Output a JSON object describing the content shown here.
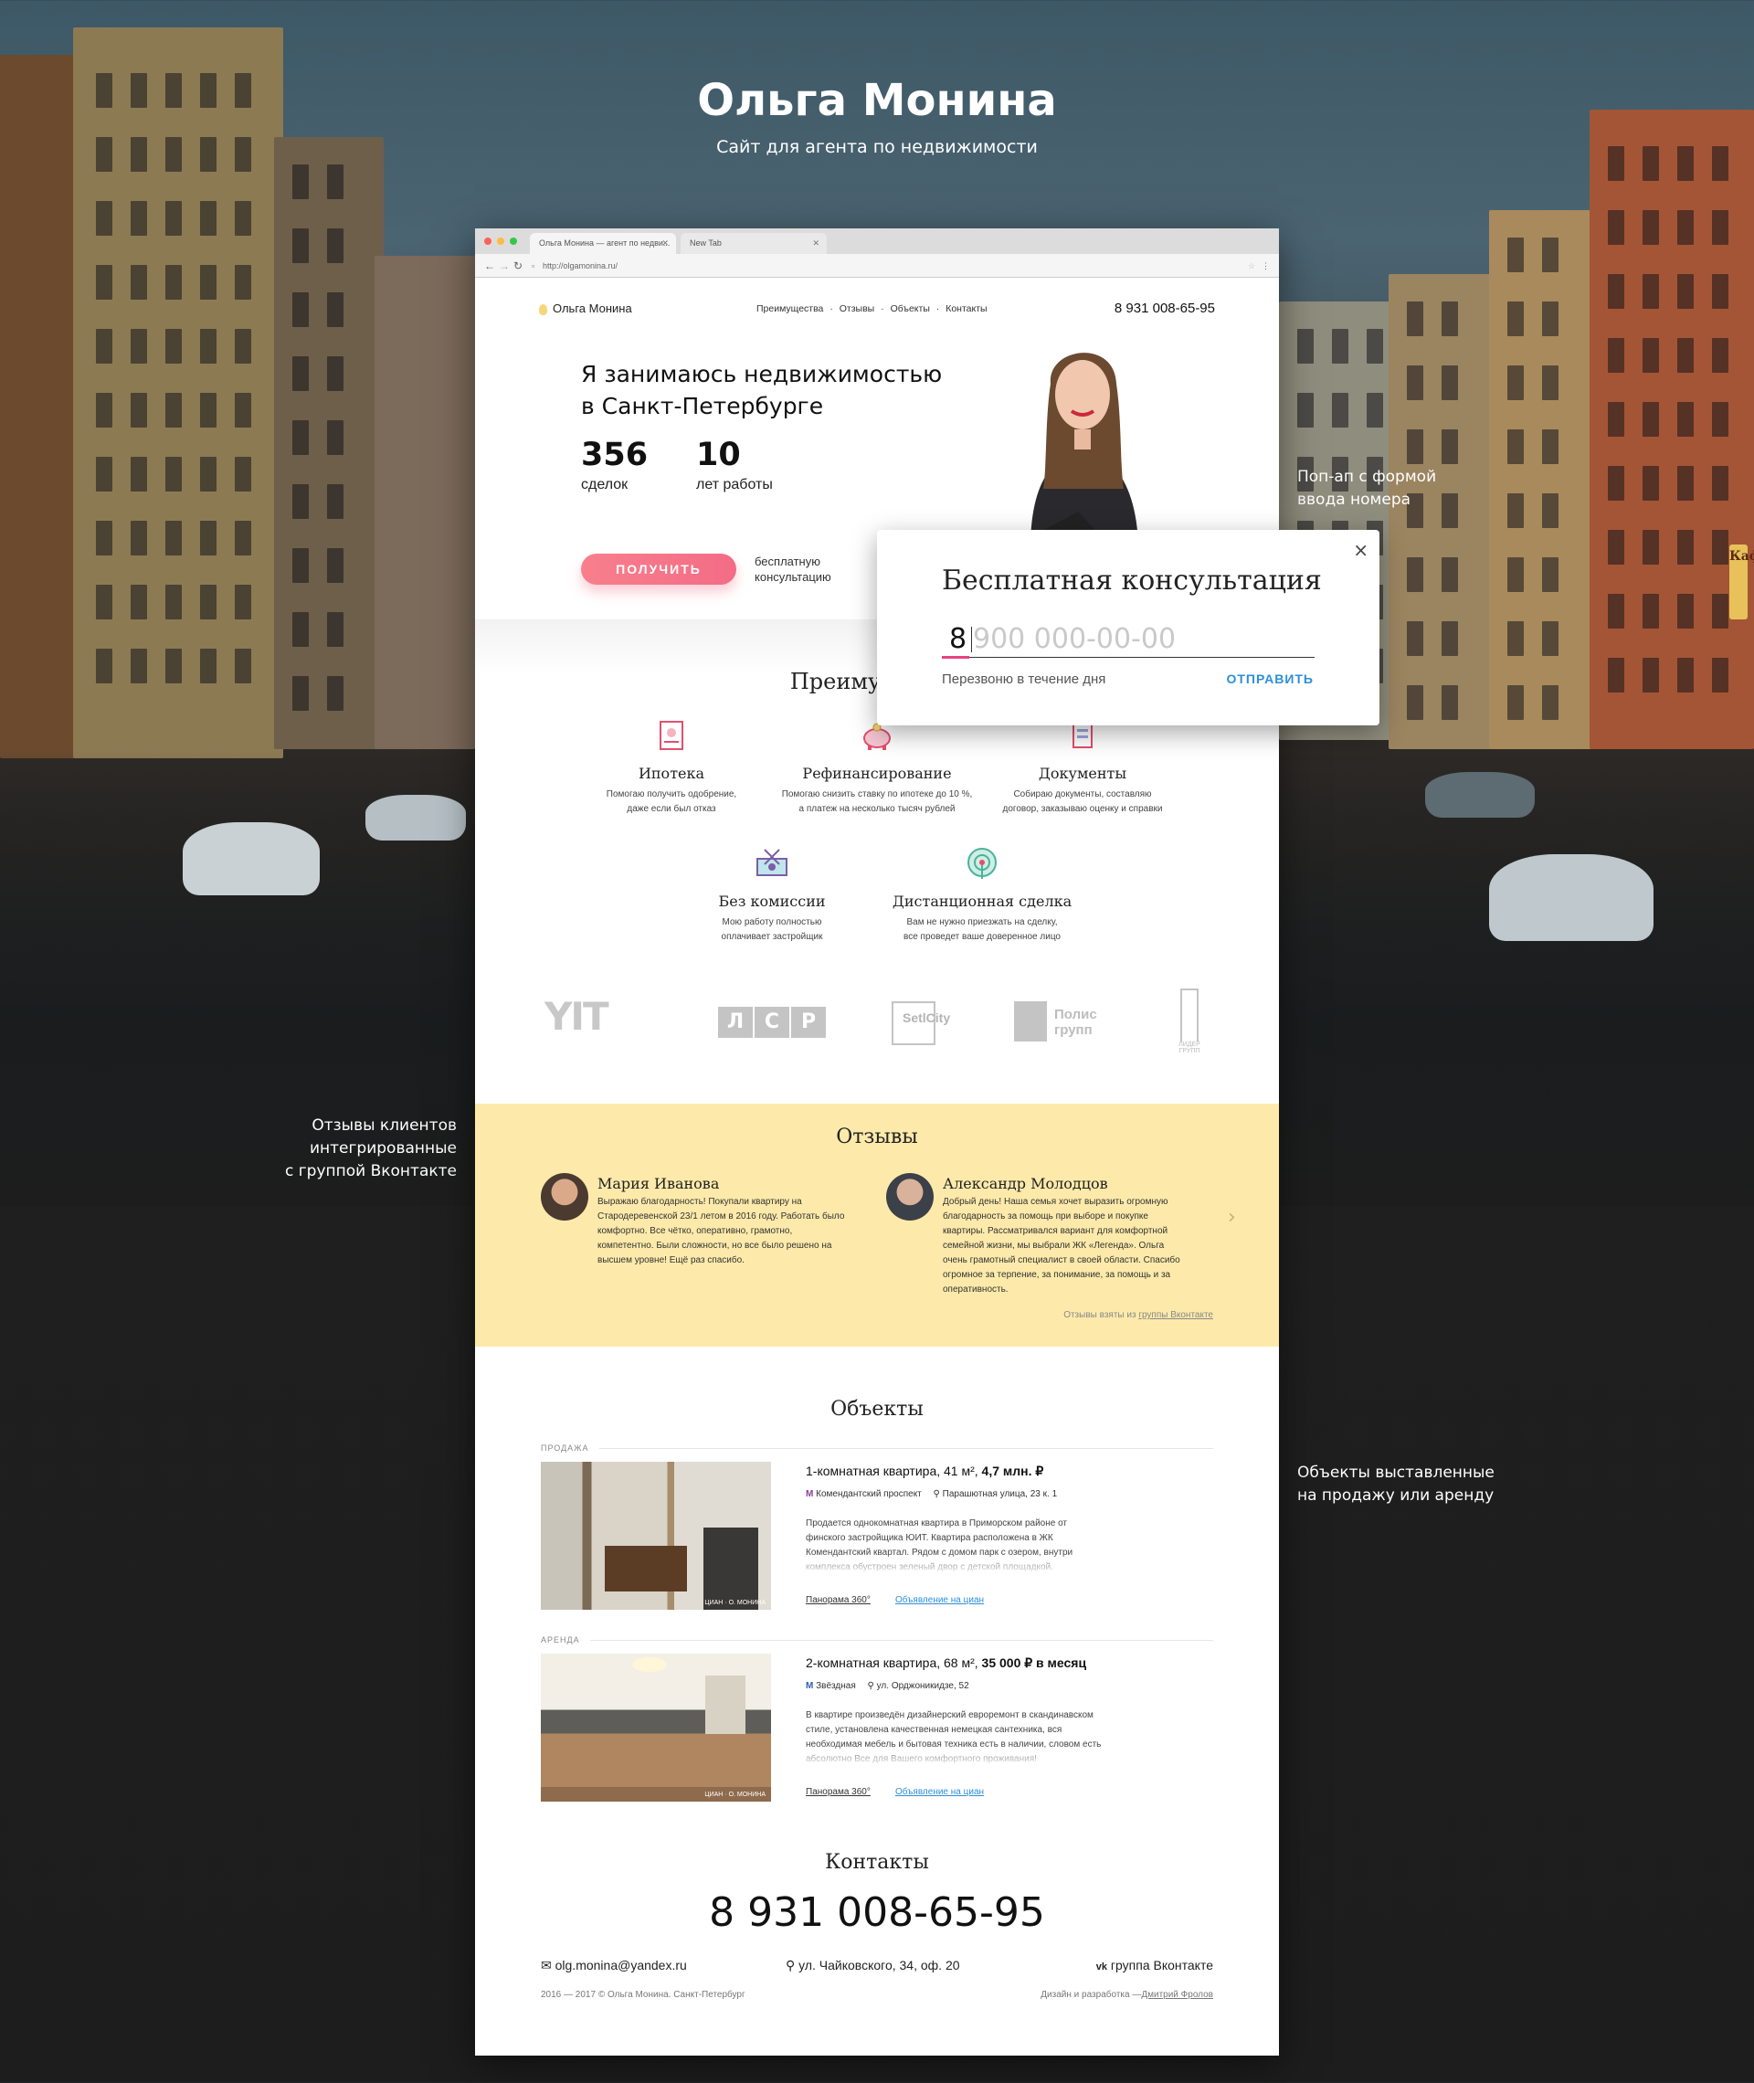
{
  "showcase": {
    "title": "Ольга Монина",
    "subtitle": "Сайт для агента по недвижимости",
    "notes": {
      "popup": [
        "Поп-ап с формой",
        "ввода номера"
      ],
      "reviews": [
        "Отзывы клиентов",
        "интегрированные",
        "с группой Вконтакте"
      ],
      "objects": [
        "Объекты выставленные",
        "на продажу или аренду"
      ]
    },
    "cafe_sign": "Кафе"
  },
  "browser": {
    "tabs": [
      {
        "label": "Ольга Монина — агент по недви..."
      },
      {
        "label": "New Tab"
      }
    ],
    "url": "http://olgamonina.ru/",
    "dots": [
      "#fc605c",
      "#fdbc40",
      "#34c84a"
    ]
  },
  "site": {
    "logo": "Ольга Монина",
    "menu": [
      "Преимущества",
      "Отзывы",
      "Объекты",
      "Контакты"
    ],
    "menu_sep": "·",
    "phone": "8 931 008-65-95",
    "hero": {
      "line1": "Я занимаюсь недвижимостью",
      "line2": "в Санкт-Петербурге",
      "stats": [
        {
          "value": "356",
          "label": "сделок"
        },
        {
          "value": "10",
          "label": "лет работы"
        }
      ],
      "cta": "ПОЛУЧИТЬ",
      "cta_note": [
        "бесплатную",
        "консультацию"
      ]
    },
    "advantages": {
      "title": "Преимущества",
      "items": [
        {
          "title": "Ипотека",
          "desc": [
            "Помогаю получить одобрение,",
            "даже если был отказ"
          ]
        },
        {
          "title": "Рефинансирование",
          "desc": [
            "Помогаю снизить ставку по ипотеке до 10 %,",
            "а платеж на несколько тысяч рублей"
          ]
        },
        {
          "title": "Документы",
          "desc": [
            "Собираю документы, составляю",
            "договор, заказываю оценку и справки"
          ]
        },
        {
          "title": "Без комиссии",
          "desc": [
            "Мою работу полностью",
            "оплачивает застройщик"
          ]
        },
        {
          "title": "Дистанционная сделка",
          "desc": [
            "Вам не нужно приезжать на сделку,",
            "все проведет ваше доверенное лицо"
          ]
        }
      ]
    },
    "partners": [
      "YIT",
      "ЛСР",
      "SetlCity",
      "Полис групп",
      "Лидер групп"
    ],
    "partner_parts": {
      "lsr": [
        "Л",
        "С",
        "Р"
      ],
      "polis": [
        "Полис",
        "групп"
      ],
      "lider": [
        "ЛИДЕР",
        "ГРУПП"
      ]
    },
    "reviews": {
      "title": "Отзывы",
      "items": [
        {
          "name": "Мария Иванова",
          "text": [
            "Выражаю благодарность! Покупали квартиру на",
            "Стародеревенской 23/1 летом в 2016 году. Работать было",
            "комфортно. Все чётко, оперативно, грамотно,",
            "компетентно. Были сложности, но все было решено на",
            "высшем уровне! Ещё раз спасибо."
          ]
        },
        {
          "name": "Александр Молодцов",
          "text": [
            "Добрый день! Наша семья хочет выразить огромную",
            "благодарность за помощь при выборе и покупке",
            "квартиры. Рассматривался вариант для комфортной",
            "семейной жизни, мы выбрали ЖК «Легенда». Ольга",
            "очень грамотный специалист в своей области. Спасибо",
            "огромное за терпение, за понимание, за помощь и за",
            "оперативность."
          ]
        }
      ],
      "source_prefix": "Отзывы взяты из",
      "source_link": "группы Вконтакте",
      "next": "›"
    },
    "objects": {
      "title": "Объекты",
      "items": [
        {
          "tag": "ПРОДАЖА",
          "title_plain": "1-комнатная квартира, 41 м²,",
          "price": "4,7 млн. ₽",
          "metro": "Комендантский проспект",
          "address": "Парашютная улица, 23 к. 1",
          "desc": [
            "Продается однокомнатная квартира в Приморском районе от",
            "финского застройщика ЮИТ. Квартира расположена в ЖК",
            "Комендантский квартал. Рядом с домом парк с озером, внутри",
            "комплекса обустроен зеленый двор с детской площадкой."
          ],
          "pano": "Панорама 360°",
          "link": "Объявление на циан",
          "watermark": "ЦИАН · О. МОНИНА"
        },
        {
          "tag": "АРЕНДА",
          "title_plain": "2-комнатная квартира, 68 м²,",
          "price": "35 000 ₽ в месяц",
          "metro": "Звёздная",
          "address": "ул. Орджоникидзе, 52",
          "desc": [
            "В квартире произведён дизайнерский евроремонт в скандинавском",
            "стиле, установлена качественная немецкая сантехника, вся",
            "необходимая мебель и бытовая техника есть в наличии, словом есть",
            "абсолютно Все для Вашего комфортного проживания!"
          ],
          "pano": "Панорама 360°",
          "link": "Объявление на циан",
          "watermark": "ЦИАН · О. МОНИНА"
        }
      ]
    },
    "contacts": {
      "title": "Контакты",
      "phone": "8 931 008-65-95",
      "email": "olg.monina@yandex.ru",
      "address": "ул. Чайковского, 34, оф. 20",
      "vk": "группа Вконтакте",
      "copyright": "2016 — 2017 © Ольга Монина. Санкт-Петербург",
      "credit_prefix": "Дизайн и разработка —",
      "credit_name": "Дмитрий Фролов"
    }
  },
  "popup": {
    "title": "Бесплатная консультация",
    "prefix": "8",
    "placeholder": "900 000-00-00",
    "hint": "Перезвоню в течение дня",
    "submit": "ОТПРАВИТЬ",
    "close": "×"
  },
  "colors": {
    "accent_pink": "#f36c86",
    "link_blue": "#2d8fd6",
    "reviews_bg": "#fdeaaa",
    "metro_purple": "#8e3c96",
    "metro_blue": "#2b5fb3"
  }
}
